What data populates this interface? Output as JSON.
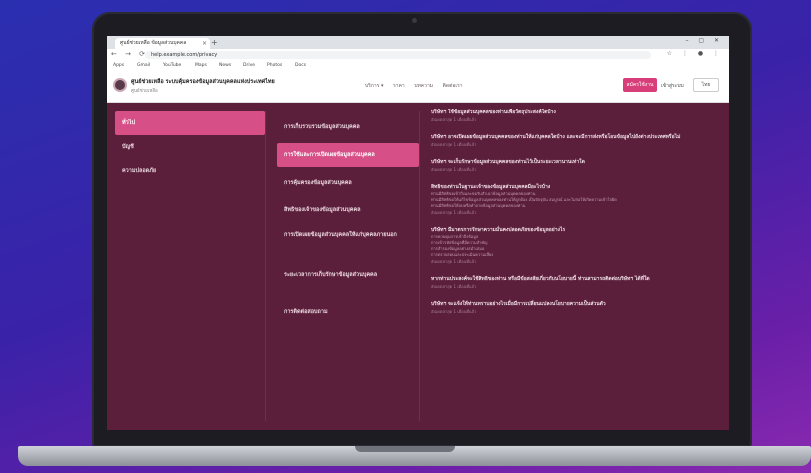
{
  "browser": {
    "tab_title": "ศูนย์ช่วยเหลือ ข้อมูลส่วนบุคคล",
    "tab_close": "×",
    "new_tab": "+",
    "window_controls": "– ▢ ✕",
    "nav_icons": "← → ⟳",
    "url": "help.example.com/privacy",
    "ext_icons": "☆ ⋮ ● ⋮",
    "bookmarks": [
      "Apps",
      "Gmail",
      "YouTube",
      "Maps",
      "News",
      "Drive",
      "Photos",
      "Docs"
    ]
  },
  "header": {
    "title": "ศูนย์ช่วยเหลือ ระบบคุ้มครองข้อมูลส่วนบุคคลแห่งประเทศไทย",
    "subtitle": "ศูนย์ช่วยเหลือ",
    "nav": [
      "บริการ ▾",
      "ราคา",
      "บทความ",
      "ติดต่อเรา"
    ],
    "signup_label": "สมัครใช้งาน",
    "login_label": "เข้าสู่ระบบ",
    "language": "ไทย"
  },
  "categories": [
    {
      "label": "ทั่วไป",
      "active": true
    },
    {
      "label": "บัญชี",
      "active": false
    },
    {
      "label": "ความปลอดภัย",
      "active": false
    }
  ],
  "subcategories": [
    {
      "label": "การเก็บรวบรวมข้อมูลส่วนบุคคล",
      "active": false
    },
    {
      "label": "การใช้และการเปิดเผยข้อมูลส่วนบุคคล",
      "active": true
    },
    {
      "label": "การคุ้มครองข้อมูลส่วนบุคคล",
      "active": false
    },
    {
      "label": "สิทธิของเจ้าของข้อมูลส่วนบุคคล",
      "active": false
    },
    {
      "label": "การเปิดเผยข้อมูลส่วนบุคคลให้แก่บุคคลภายนอก",
      "active": false
    },
    {
      "label": "ระยะเวลาการเก็บรักษาข้อมูลส่วนบุคคล",
      "active": false
    },
    {
      "label": "การติดต่อสอบถาม",
      "active": false
    }
  ],
  "faqs": [
    {
      "q": "บริษัทฯ ใช้ข้อมูลส่วนบุคคลของท่านเพื่อวัตถุประสงค์ใดบ้าง",
      "a": [],
      "meta": "อัปเดตล่าสุด 1 เดือนที่แล้ว"
    },
    {
      "q": "บริษัทฯ อาจเปิดเผยข้อมูลส่วนบุคคลของท่านให้แก่บุคคลใดบ้าง และจะมีการส่งหรือโอนข้อมูลไปยังต่างประเทศหรือไม่",
      "a": [],
      "meta": "อัปเดตล่าสุด 1 เดือนที่แล้ว"
    },
    {
      "q": "บริษัทฯ จะเก็บรักษาข้อมูลส่วนบุคคลของท่านไว้เป็นระยะเวลานานเท่าใด",
      "a": [],
      "meta": "อัปเดตล่าสุด 1 เดือนที่แล้ว"
    },
    {
      "q": "สิทธิของท่านในฐานะเจ้าของข้อมูลส่วนบุคคลมีอะไรบ้าง",
      "a": [
        "ท่านมีสิทธิขอเข้าถึงและขอรับสำเนาข้อมูลส่วนบุคคลของท่าน",
        "ท่านมีสิทธิขอให้แก้ไขข้อมูลส่วนบุคคลของท่านให้ถูกต้อง เป็นปัจจุบัน สมบูรณ์ และไม่ก่อให้เกิดความเข้าใจผิด",
        "ท่านมีสิทธิขอให้ลบหรือทำลายข้อมูลส่วนบุคคลของท่าน"
      ],
      "meta": "อัปเดตล่าสุด 1 เดือนที่แล้ว"
    },
    {
      "q": "บริษัทฯ มีมาตรการรักษาความมั่นคงปลอดภัยของข้อมูลอย่างไร",
      "a": [
        "การควบคุมการเข้าถึงข้อมูล",
        "การเข้ารหัสข้อมูลที่มีความสำคัญ",
        "การสำรองข้อมูลอย่างสม่ำเสมอ",
        "การตรวจสอบและประเมินความเสี่ยง"
      ],
      "meta": "อัปเดตล่าสุด 1 เดือนที่แล้ว"
    },
    {
      "q": "หากท่านประสงค์จะใช้สิทธิของท่าน หรือมีข้อสงสัยเกี่ยวกับนโยบายนี้ ท่านสามารถติดต่อบริษัทฯ ได้ที่ใด",
      "a": [],
      "meta": "อัปเดตล่าสุด 1 เดือนที่แล้ว"
    },
    {
      "q": "บริษัทฯ จะแจ้งให้ท่านทราบอย่างไรเมื่อมีการเปลี่ยนแปลงนโยบายความเป็นส่วนตัว",
      "a": [],
      "meta": "อัปเดตล่าสุด 1 เดือนที่แล้ว"
    }
  ]
}
